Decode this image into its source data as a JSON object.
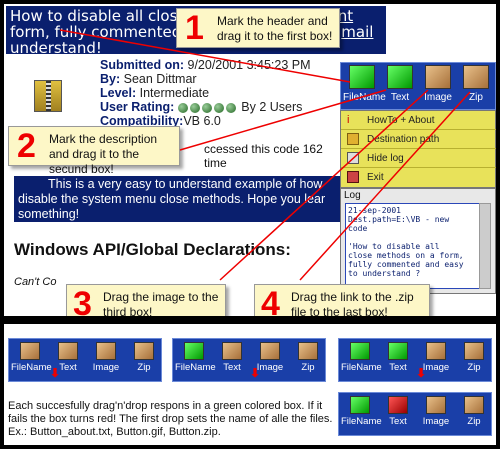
{
  "page": {
    "header_text_1": "How to disable all clos",
    "header_text_2": "rint",
    "header_text_3": "form, fully commented",
    "header_text_4": "mail",
    "header_text_5": "understand!",
    "submitted_label": "Submitted on:",
    "submitted_value": "9/20/2001 3:45:23 PM",
    "by_label": "By:",
    "by_value": "Sean Dittmar",
    "level_label": "Level:",
    "level_value": "Intermediate",
    "rating_label": "User Rating:",
    "rating_value": "By 2 Users",
    "compat_label": "Compatibility:",
    "compat_value": "VB 6.0",
    "accessed_text": "ccessed this code 162 time",
    "desc_line1": "This is a very easy to understand example of how",
    "desc_line2": "disable the system menu close methods. Hope you lear",
    "desc_line3": "something!",
    "api_title": "Windows API/Global Declarations:",
    "cant_text": "Can't Co"
  },
  "app": {
    "boxes": [
      {
        "label": "FileName",
        "color": "green"
      },
      {
        "label": "Text",
        "color": "green"
      },
      {
        "label": "Image",
        "color": "brown"
      },
      {
        "label": "Zip",
        "color": "brown"
      }
    ],
    "menu": [
      {
        "label": "HowTo + About",
        "icon": "info-icon"
      },
      {
        "label": "Destination path",
        "icon": "folder-icon"
      },
      {
        "label": "Hide log",
        "icon": "log-icon"
      },
      {
        "label": "Exit",
        "icon": "exit-icon"
      }
    ],
    "log_title": "Log",
    "log_text": "21-sep-2001\nDest.path=E:\\VB - new\ncode\n\n'How to disable all\nclose methods on a form,\nfully commented and easy\nto understand ?\n\n~How to disable all close\nmethods on a form, fully"
  },
  "callouts": {
    "c1_num": "1",
    "c1_text": "Mark the header and drag it to the first box!",
    "c2_num": "2",
    "c2_text": "Mark the description and drag it to the secund box!",
    "c3_num": "3",
    "c3_text": "Drag the image to the third box!",
    "c4_num": "4",
    "c4_text": "Drag the link to the .zip file to the last box!"
  },
  "bottom": {
    "labels": [
      "FileName",
      "Text",
      "Image",
      "Zip"
    ],
    "explanation": "Each succesfully drag'n'drop respons in a green colored box. If it fails the box turns red! The first drop sets the name of alle the files. Ex.: Button_about.txt, Button.gif, Button.zip."
  },
  "colors": {
    "selection_bg": "#0a1f6e",
    "box_bar": "#1a3fa8",
    "menu_bg": "#e8e25a",
    "callout_bg": "#fdf7c7",
    "callout_number": "#e00000"
  }
}
